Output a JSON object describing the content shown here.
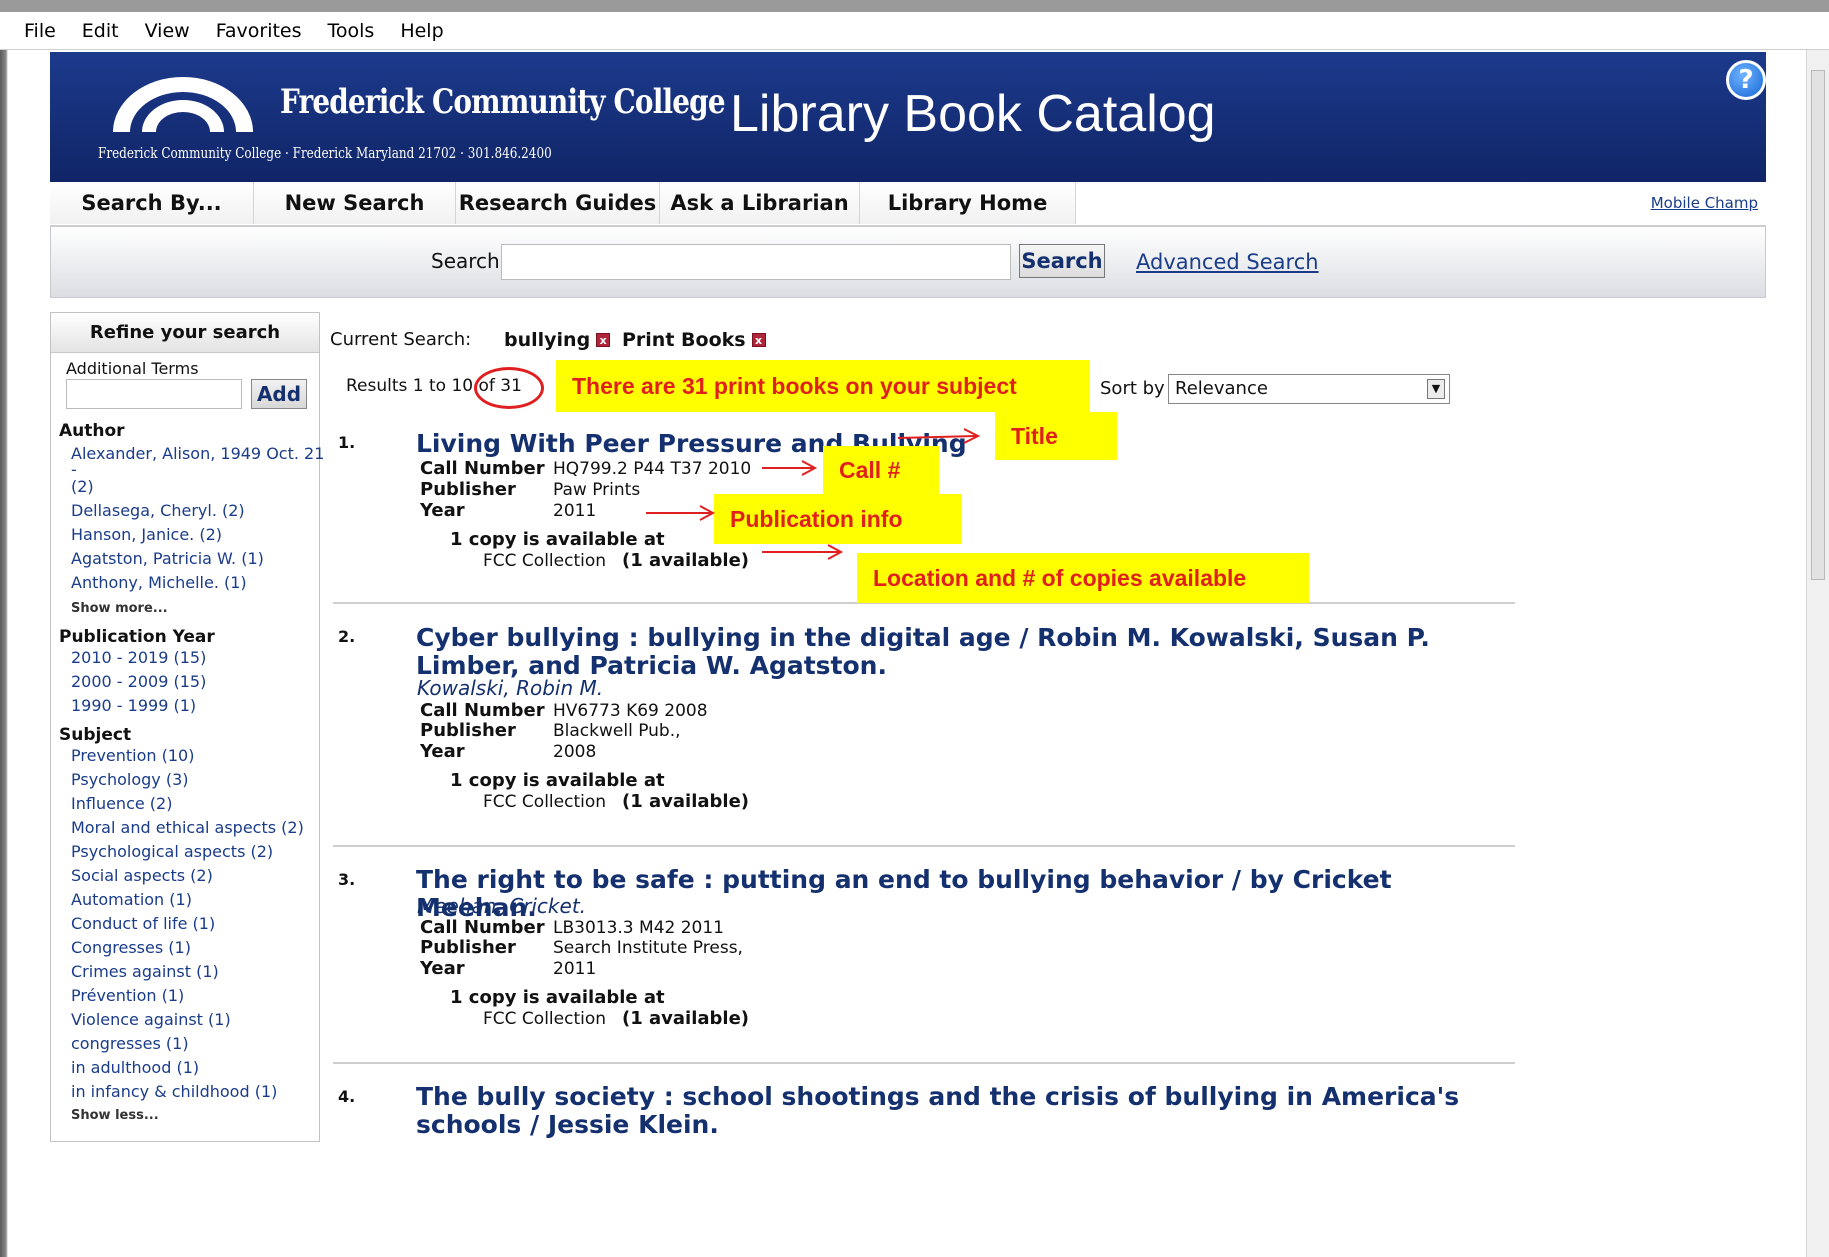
{
  "menubar": {
    "items": [
      "File",
      "Edit",
      "View",
      "Favorites",
      "Tools",
      "Help"
    ]
  },
  "banner": {
    "college_name": "Frederick Community College",
    "address": "Frederick Community College · Frederick Maryland 21702 · 301.846.2400",
    "catalog_title": "Library Book Catalog",
    "help_icon": "?"
  },
  "nav": {
    "tabs": [
      "Search By...",
      "New Search",
      "Research Guides",
      "Ask a Librarian",
      "Library Home Page"
    ],
    "mobile_link": "Mobile Champ"
  },
  "search": {
    "label": "Search",
    "button": "Search",
    "value": "",
    "advanced_link": "Advanced Search"
  },
  "refine": {
    "title": "Refine your search",
    "additional_terms_label": "Additional Terms",
    "add_button": "Add",
    "author_heading": "Author",
    "authors": [
      "Alexander, Alison, 1949 Oct. 21",
      "-",
      "(2)",
      "Dellasega, Cheryl. (2)",
      "Hanson, Janice. (2)",
      "Agatston, Patricia W. (1)",
      "Anthony, Michelle. (1)"
    ],
    "show_more": "Show more...",
    "pubyear_heading": "Publication Year",
    "pubyears": [
      "2010 - 2019 (15)",
      "2000 - 2009 (15)",
      "1990 - 1999 (1)"
    ],
    "subject_heading": "Subject",
    "subjects": [
      "Prevention (10)",
      "Psychology (3)",
      "Influence (2)",
      "Moral and ethical aspects (2)",
      "Psychological aspects (2)",
      "Social aspects (2)",
      "Automation (1)",
      "Conduct of life (1)",
      "Congresses (1)",
      "Crimes against (1)",
      "Prévention (1)",
      "Violence against (1)",
      "congresses (1)",
      "in adulthood (1)",
      "in infancy & childhood (1)"
    ],
    "show_less": "Show less..."
  },
  "current_search": {
    "label": "Current Search:",
    "chips": [
      "bullying",
      "Print Books"
    ],
    "remove_icon": "x"
  },
  "results_info": {
    "text": "Results 1 to 10 of 31"
  },
  "sort": {
    "label": "Sort by",
    "selected": "Relevance"
  },
  "field_labels": {
    "call_number": "Call Number",
    "publisher": "Publisher",
    "year": "Year"
  },
  "results": [
    {
      "num": "1.",
      "title": "Living With Peer Pressure and Bullying",
      "author": "",
      "call_number": "HQ799.2 P44 T37 2010",
      "publisher": "Paw Prints",
      "year": "2011",
      "copies": "1 copy is available at",
      "location": "FCC Collection",
      "available": "(1 available)"
    },
    {
      "num": "2.",
      "title": "Cyber bullying : bullying in the digital age / Robin M. Kowalski, Susan P. Limber, and Patricia W. Agatston.",
      "author": "Kowalski, Robin M.",
      "call_number": "HV6773 K69 2008",
      "publisher": "Blackwell Pub.,",
      "year": "2008",
      "copies": "1 copy is available at",
      "location": "FCC Collection",
      "available": "(1 available)"
    },
    {
      "num": "3.",
      "title": "The right to be safe : putting an end to bullying behavior / by Cricket Meehan.",
      "author": "Meehan, Cricket.",
      "call_number": "LB3013.3 M42 2011",
      "publisher": "Search Institute Press,",
      "year": "2011",
      "copies": "1 copy is available at",
      "location": "FCC Collection",
      "available": "(1 available)"
    },
    {
      "num": "4.",
      "title": "The bully society : school shootings and the crisis of bullying in America's schools / Jessie Klein."
    }
  ],
  "annotations": {
    "count_note": "There are 31 print books on your subject",
    "title_note": "Title",
    "call_note": "Call #",
    "pub_note": "Publication info",
    "location_note": "Location and # of copies available"
  },
  "colors": {
    "banner": "#132c73",
    "link": "#1a3c8a",
    "callout_bg": "#ffff00",
    "callout_text": "#e0201a"
  }
}
